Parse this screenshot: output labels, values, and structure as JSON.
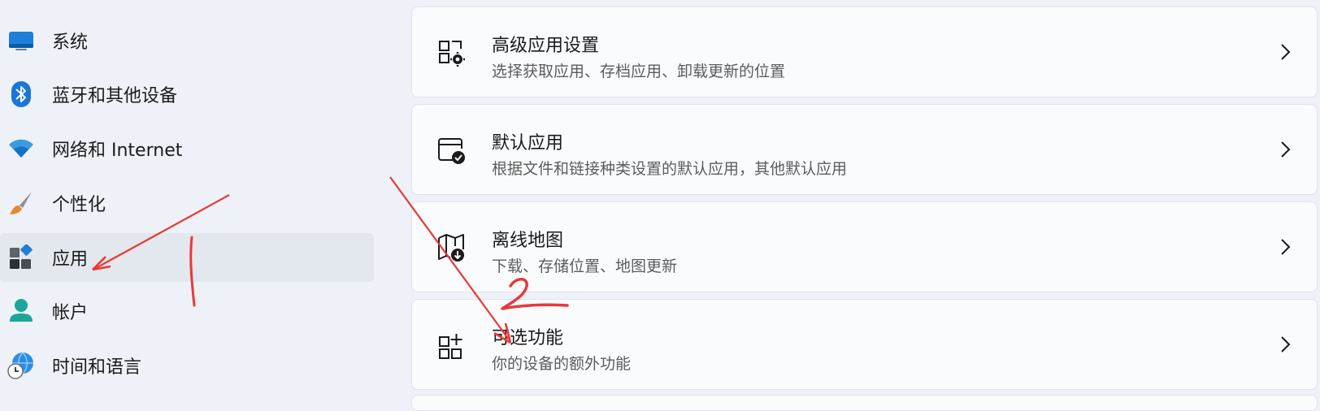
{
  "sidebar": {
    "items": [
      {
        "label": "系统",
        "icon": "monitor-icon"
      },
      {
        "label": "蓝牙和其他设备",
        "icon": "bluetooth-icon"
      },
      {
        "label": "网络和 Internet",
        "icon": "wifi-icon"
      },
      {
        "label": "个性化",
        "icon": "paintbrush-icon"
      },
      {
        "label": "应用",
        "icon": "apps-icon",
        "selected": true
      },
      {
        "label": "帐户",
        "icon": "person-icon"
      },
      {
        "label": "时间和语言",
        "icon": "globe-clock-icon"
      }
    ]
  },
  "main": {
    "cards": [
      {
        "title": "高级应用设置",
        "description": "选择获取应用、存档应用、卸载更新的位置",
        "icon": "app-settings-icon"
      },
      {
        "title": "默认应用",
        "description": "根据文件和链接种类设置的默认应用，其他默认应用",
        "icon": "default-apps-icon"
      },
      {
        "title": "离线地图",
        "description": "下载、存储位置、地图更新",
        "icon": "offline-map-icon"
      },
      {
        "title": "可选功能",
        "description": "你的设备的额外功能",
        "icon": "optional-features-icon"
      }
    ]
  },
  "annotations": {
    "marks": [
      "1",
      "2"
    ],
    "color": "#e8393a"
  }
}
